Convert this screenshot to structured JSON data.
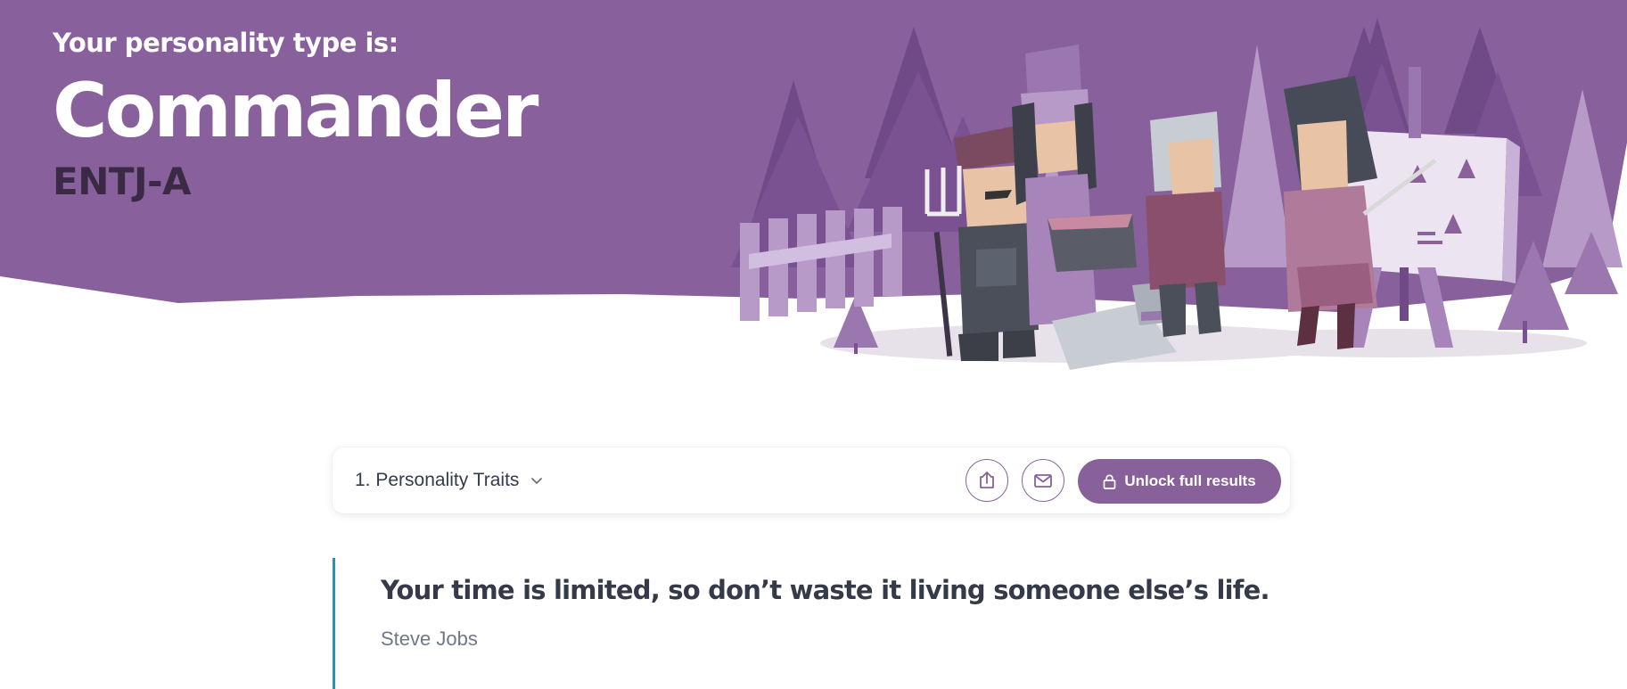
{
  "hero": {
    "intro": "Your personality type is:",
    "type_name": "Commander",
    "type_code": "ENTJ-A",
    "colors": {
      "background": "#88609c",
      "code_text": "#3a2a45"
    }
  },
  "toolbar": {
    "section_label": "1. Personality Traits",
    "section_icon": "chevron-down-icon",
    "share_icon": "share-icon",
    "email_icon": "mail-icon",
    "unlock_label": "Unlock full results",
    "unlock_icon": "lock-icon",
    "accent": "#88619a"
  },
  "quote": {
    "text": "Your time is limited, so don’t waste it living someone else’s life.",
    "author": "Steve Jobs",
    "border_color": "#2e8fb2"
  }
}
